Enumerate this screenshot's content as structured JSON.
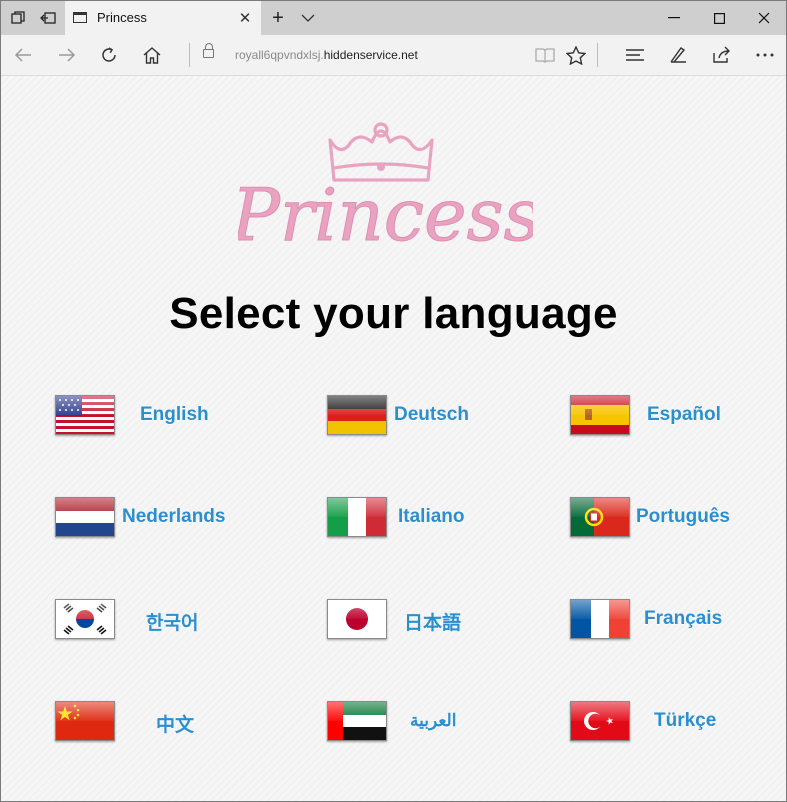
{
  "browser": {
    "tab": {
      "title": "Princess"
    },
    "address": {
      "url_prefix": "royall6qpvndxlsj.",
      "url_host": "hiddenservice.net"
    }
  },
  "page": {
    "logo_text": "Princess",
    "heading": "Select your language",
    "languages": [
      {
        "label": "English",
        "flag": "us-flag-icon"
      },
      {
        "label": "Deutsch",
        "flag": "germany-flag-icon"
      },
      {
        "label": "Español",
        "flag": "spain-flag-icon"
      },
      {
        "label": "Nederlands",
        "flag": "netherlands-flag-icon"
      },
      {
        "label": "Italiano",
        "flag": "italy-flag-icon"
      },
      {
        "label": "Português",
        "flag": "portugal-flag-icon"
      },
      {
        "label": "한국어",
        "flag": "south-korea-flag-icon"
      },
      {
        "label": "日本語",
        "flag": "japan-flag-icon"
      },
      {
        "label": "Français",
        "flag": "france-flag-icon"
      },
      {
        "label": "中文",
        "flag": "china-flag-icon"
      },
      {
        "label": "العربية",
        "flag": "uae-flag-icon"
      },
      {
        "label": "Türkçe",
        "flag": "turkey-flag-icon"
      }
    ],
    "colors": {
      "link": "#2a8fce",
      "logo_pink": "#e9a3c1"
    }
  }
}
